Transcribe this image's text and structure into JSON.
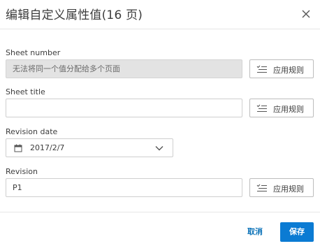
{
  "dialog": {
    "title": "编辑自定义属性值(16 页)"
  },
  "fields": {
    "sheet_number": {
      "label": "Sheet number",
      "value": "无法将同一个值分配给多个页面",
      "rule_button": "应用规则"
    },
    "sheet_title": {
      "label": "Sheet title",
      "value": "",
      "rule_button": "应用规则"
    },
    "revision_date": {
      "label": "Revision date",
      "value": "2017/2/7"
    },
    "revision": {
      "label": "Revision",
      "value": "P1",
      "rule_button": "应用规则"
    }
  },
  "footer": {
    "cancel_label": "取消",
    "save_label": "保存"
  },
  "colors": {
    "accent": "#0b7bd3",
    "link": "#0b72b8",
    "disabled_bg": "#e3e3e3"
  },
  "icons": [
    "close-icon",
    "list-rules-icon",
    "calendar-icon",
    "chevron-down-icon"
  ]
}
